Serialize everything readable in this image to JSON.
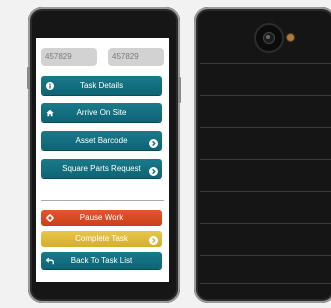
{
  "fields": {
    "left_value": "457829",
    "right_value": "457829"
  },
  "buttons": {
    "task_details": "Task Details",
    "arrive_on_site": "Arrive On Site",
    "asset_barcode": "Asset Barcode",
    "square_parts_request": "Square Parts Request",
    "pause_work": "Pause Work",
    "complete_task": "Complete Task",
    "back_to_task_list": "Back To Task List"
  },
  "icons": {
    "task_details": "info-icon",
    "arrive_on_site": "home-icon",
    "asset_barcode": "chevron-right-circle-icon",
    "square_parts_request": "chevron-right-circle-icon",
    "pause_work": "gear-icon",
    "complete_task": "chevron-right-circle-icon",
    "back_to_task_list": "back-arrow-icon"
  },
  "colors": {
    "teal": "#0f6b7c",
    "red": "#d44a22",
    "yellow": "#e0bb3c",
    "phone_body": "#161616",
    "field_bg": "#d2d2d2"
  }
}
